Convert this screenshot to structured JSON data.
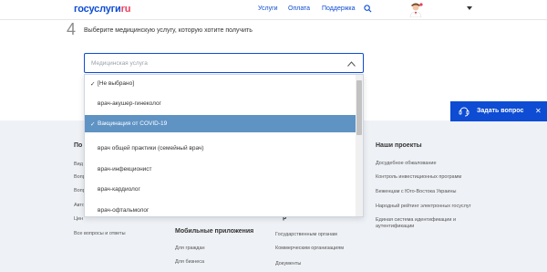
{
  "header": {
    "logo_a": "госуслуги",
    "logo_b": "ru",
    "nav": [
      "Услуги",
      "Оплата",
      "Поддержка"
    ]
  },
  "step": {
    "number": "4",
    "text": "Выберите медицинскую услугу, которую хотите получить"
  },
  "select": {
    "placeholder": "Медицинская услуга"
  },
  "dropdown": {
    "options": [
      "[Не выбрано]",
      "врач-акушер-гинеколог",
      "Вакцинация от COVID-19",
      "врач общей практики (семейный врач)",
      "врач-инфекционист",
      "врач-кардиолог",
      "врач-офтальмолог"
    ],
    "selected_index": 2,
    "checkmark": "✓"
  },
  "footer": {
    "col1_head": "По",
    "col1_links": [
      "Вид",
      "Вопр",
      "Вопр",
      "Авто",
      "Цен"
    ],
    "col1_bottom": "Все вопросы и ответы",
    "col2_head": "Мобильные приложения",
    "col2_links": [
      "Для граждан",
      "Для бизнеса"
    ],
    "col3_head_partial": "р",
    "col3_links": [
      "Государственным органам",
      "Коммерческим организациям",
      "Документы"
    ],
    "col4_head": "Наши проекты",
    "col4_links": [
      "Досудебное обжалование",
      "Контроль инвестиционных программ",
      "Беженцам с Юго-Востока Украины",
      "Народный рейтинг электронных госуслуг",
      "Единая система идентификации и",
      "аутентификации"
    ]
  },
  "ask": {
    "label": "Задать вопрос",
    "close": "✕"
  },
  "colors": {
    "brand_blue": "#0d4cd3",
    "brand_red": "#ee3f58",
    "selected_option": "#5f93c4",
    "footer_bg": "#eef1f5"
  }
}
